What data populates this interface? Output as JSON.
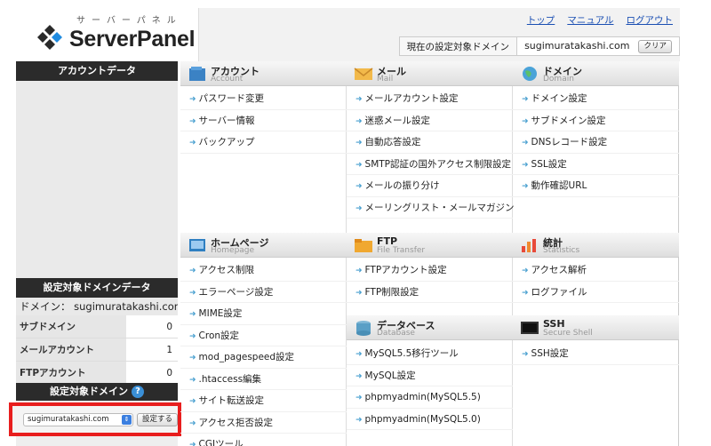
{
  "logo": {
    "kana": "サーバーパネル",
    "name": "ServerPanel"
  },
  "top_links": [
    "トップ",
    "マニュアル",
    "ログアウト"
  ],
  "target": {
    "label": "現在の設定対象ドメイン",
    "domain": "sugimuratakashi.com",
    "clear": "クリア"
  },
  "left": {
    "account_header": "アカウントデータ",
    "domain_data_header": "設定対象ドメインデータ",
    "domain_line": "ドメイン： sugimuratakashi.com",
    "stats": [
      {
        "label": "サブドメイン",
        "value": "0"
      },
      {
        "label": "メールアカウント",
        "value": "1"
      },
      {
        "label": "FTPアカウント",
        "value": "0"
      }
    ],
    "select_header": "設定対象ドメイン",
    "select_value": "sugimuratakashi.com",
    "set_button": "設定する"
  },
  "sections": {
    "account": {
      "title": "アカウント",
      "sub": "Account",
      "items": [
        "パスワード変更",
        "サーバー情報",
        "バックアップ"
      ]
    },
    "mail": {
      "title": "メール",
      "sub": "Mail",
      "items": [
        "メールアカウント設定",
        "迷惑メール設定",
        "自動応答設定",
        "SMTP認証の国外アクセス制限設定",
        "メールの振り分け",
        "メーリングリスト・メールマガジン"
      ]
    },
    "domain": {
      "title": "ドメイン",
      "sub": "Domain",
      "items": [
        "ドメイン設定",
        "サブドメイン設定",
        "DNSレコード設定",
        "SSL設定",
        "動作確認URL"
      ]
    },
    "homepage": {
      "title": "ホームページ",
      "sub": "Homepage",
      "items": [
        "アクセス制限",
        "エラーページ設定",
        "MIME設定",
        "Cron設定",
        "mod_pagespeed設定",
        ".htaccess編集",
        "サイト転送設定",
        "アクセス拒否設定",
        "CGIツール"
      ]
    },
    "ftp": {
      "title": "FTP",
      "sub": "File Transfer",
      "items": [
        "FTPアカウント設定",
        "FTP制限設定"
      ]
    },
    "database": {
      "title": "データベース",
      "sub": "Database",
      "items": [
        "MySQL5.5移行ツール",
        "MySQL設定",
        "phpmyadmin(MySQL5.5)",
        "phpmyadmin(MySQL5.0)"
      ]
    },
    "stats": {
      "title": "統計",
      "sub": "Statistics",
      "items": [
        "アクセス解析",
        "ログファイル"
      ]
    },
    "ssh": {
      "title": "SSH",
      "sub": "Secure Shell",
      "items": [
        "SSH設定"
      ]
    }
  }
}
